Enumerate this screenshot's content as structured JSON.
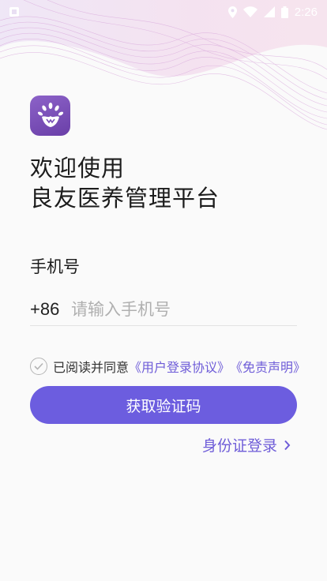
{
  "status_bar": {
    "time": "2:26"
  },
  "welcome": {
    "line1": "欢迎使用",
    "line2": "良友医养管理平台"
  },
  "form": {
    "phone_label": "手机号",
    "country_code": "+86",
    "phone_placeholder": "请输入手机号",
    "phone_value": ""
  },
  "agreement": {
    "prefix": "已阅读并同意",
    "user_agreement": "《用户登录协议》",
    "disclaimer": "《免责声明》",
    "checked": false
  },
  "actions": {
    "get_code_label": "获取验证码",
    "id_login_label": "身份证登录"
  },
  "colors": {
    "accent": "#6c5ddf",
    "logo": "#7a4fb8",
    "wave": "#e4c6ee"
  },
  "icons": [
    "notification-icon",
    "location-icon",
    "wifi-icon",
    "signal-icon",
    "battery-icon",
    "app-logo-icon",
    "check-icon",
    "chevron-right-icon"
  ]
}
